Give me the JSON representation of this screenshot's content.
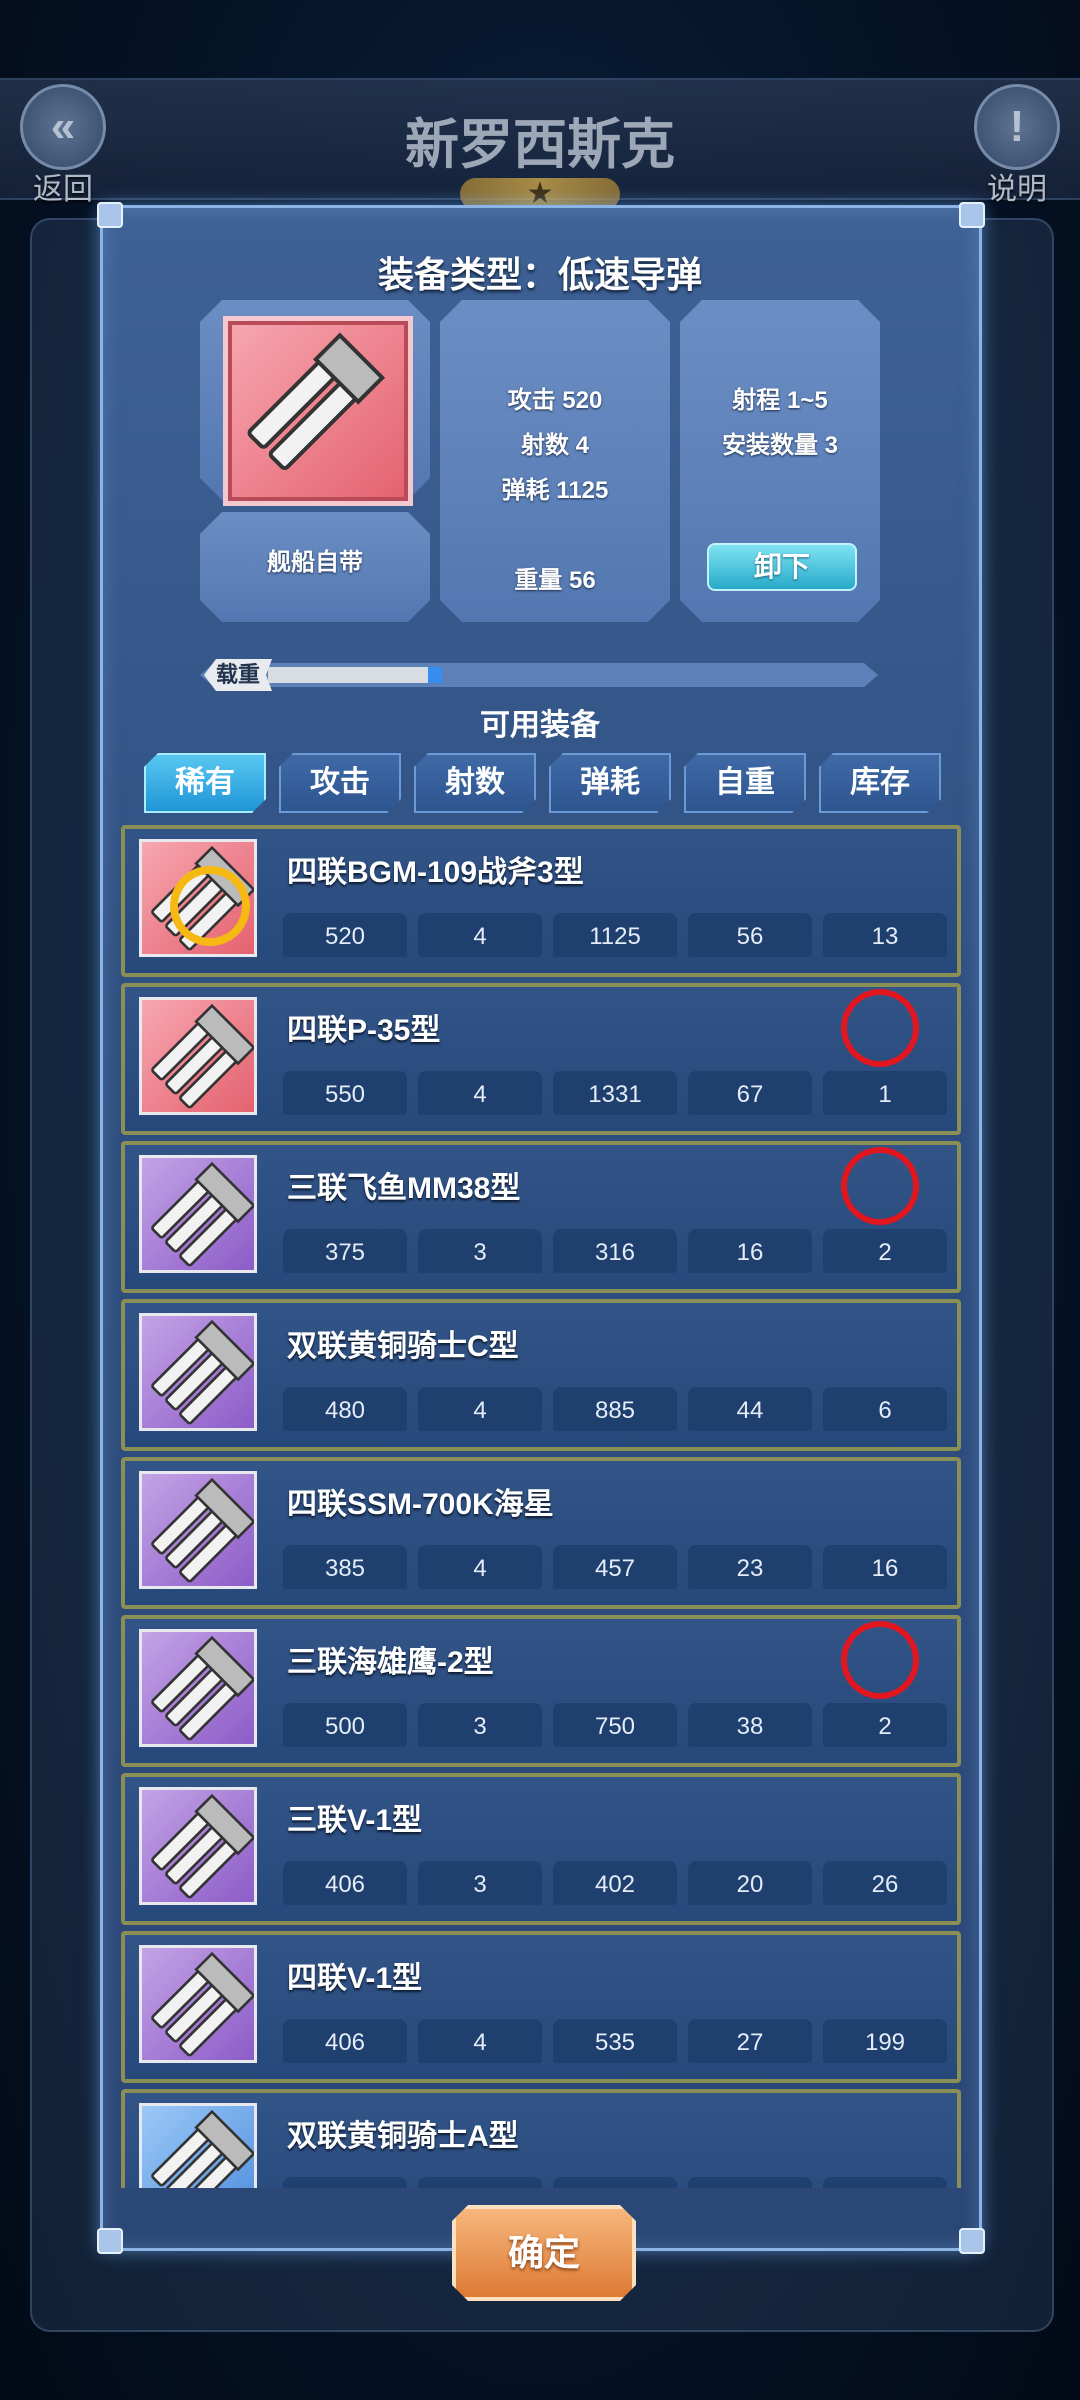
{
  "header": {
    "title": "新罗西斯克",
    "back_label": "返回",
    "help_label": "说明",
    "back_icon": "«",
    "help_icon": "!"
  },
  "equip": {
    "type_title": "装备类型：低速导弹",
    "source": "舰船自带",
    "attack": "攻击 520",
    "shots": "射数 4",
    "ammo": "弹耗 1125",
    "weight": "重量 56",
    "range": "射程 1~5",
    "install": "安装数量 3",
    "unload_label": "卸下"
  },
  "weight_bar": {
    "label": "载重",
    "fill_fraction": 0.37
  },
  "available_title": "可用装备",
  "tabs": [
    {
      "label": "稀有",
      "active": true
    },
    {
      "label": "攻击",
      "active": false
    },
    {
      "label": "射数",
      "active": false
    },
    {
      "label": "弹耗",
      "active": false
    },
    {
      "label": "自重",
      "active": false
    },
    {
      "label": "库存",
      "active": false
    }
  ],
  "items": [
    {
      "name": "四联BGM-109战斧3型",
      "rarity": "red",
      "values": [
        "520",
        "4",
        "1125",
        "56",
        "13"
      ],
      "equipped": true,
      "stamp": false
    },
    {
      "name": "四联P-35型",
      "rarity": "red",
      "values": [
        "550",
        "4",
        "1331",
        "67",
        "1"
      ],
      "equipped": false,
      "stamp": true
    },
    {
      "name": "三联飞鱼MM38型",
      "rarity": "purple",
      "values": [
        "375",
        "3",
        "316",
        "16",
        "2"
      ],
      "equipped": false,
      "stamp": true
    },
    {
      "name": "双联黄铜骑士C型",
      "rarity": "purple",
      "values": [
        "480",
        "4",
        "885",
        "44",
        "6"
      ],
      "equipped": false,
      "stamp": false
    },
    {
      "name": "四联SSM-700K海星",
      "rarity": "purple",
      "values": [
        "385",
        "4",
        "457",
        "23",
        "16"
      ],
      "equipped": false,
      "stamp": true,
      "stamp_hidden": true
    },
    {
      "name": "三联海雄鹰-2型",
      "rarity": "purple",
      "values": [
        "500",
        "3",
        "750",
        "38",
        "2"
      ],
      "equipped": false,
      "stamp": true
    },
    {
      "name": "三联V-1型",
      "rarity": "purple",
      "values": [
        "406",
        "3",
        "402",
        "20",
        "26"
      ],
      "equipped": false,
      "stamp": false
    },
    {
      "name": "四联V-1型",
      "rarity": "purple",
      "values": [
        "406",
        "4",
        "535",
        "27",
        "199"
      ],
      "equipped": false,
      "stamp": false
    },
    {
      "name": "双联黄铜骑士A型",
      "rarity": "blue",
      "values": [
        "",
        "",
        "",
        "",
        ""
      ],
      "equipped": false,
      "stamp": false
    }
  ],
  "confirm_label": "确定",
  "colors": {
    "modal_bg": "#2f4f80",
    "tab_active": "#1f95d6",
    "stamp_red": "#e2161f",
    "confirm_orange": "#dd7a35"
  }
}
